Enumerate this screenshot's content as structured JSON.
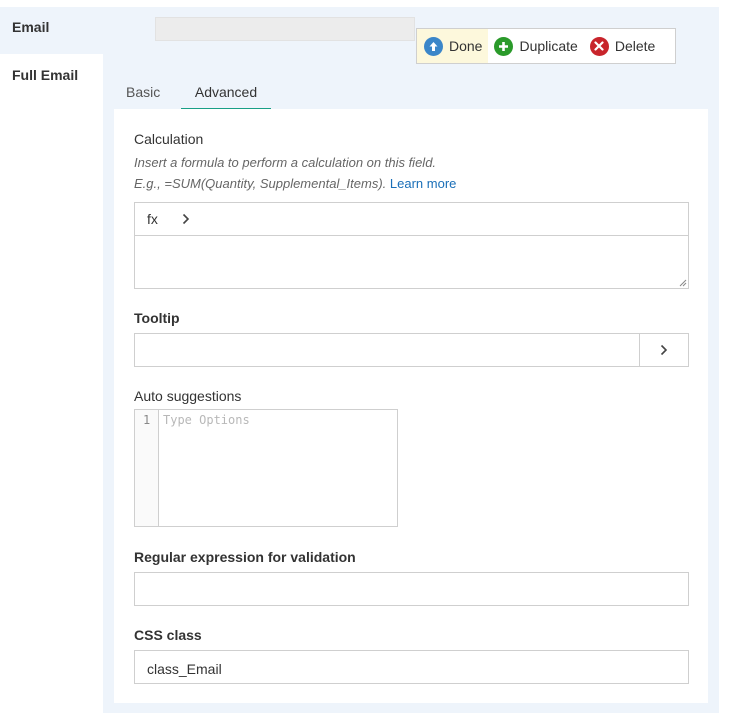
{
  "field": {
    "name": "Email",
    "full_label": "Full Email"
  },
  "toolbar": {
    "done": "Done",
    "duplicate": "Duplicate",
    "delete": "Delete"
  },
  "tabs": {
    "basic": "Basic",
    "advanced": "Advanced"
  },
  "calculation": {
    "heading": "Calculation",
    "hint_line1": "Insert a formula to perform a calculation on this field.",
    "hint_line2": "E.g., =SUM(Quantity, Supplemental_Items).",
    "learn_more": "Learn more",
    "fx_label": "fx"
  },
  "tooltip": {
    "heading": "Tooltip",
    "value": ""
  },
  "auto_suggestions": {
    "heading": "Auto suggestions",
    "line_number": "1",
    "placeholder": "Type Options"
  },
  "regex": {
    "heading": "Regular expression for validation",
    "value": ""
  },
  "css_class": {
    "heading": "CSS class",
    "value": "class_Email"
  },
  "colors": {
    "accent": "#199f86",
    "panel_bg": "#eef4fb",
    "done_icon": "#3b86c9",
    "duplicate_icon": "#2a9a2a",
    "delete_icon": "#c8242b",
    "link": "#1a6fb8"
  }
}
